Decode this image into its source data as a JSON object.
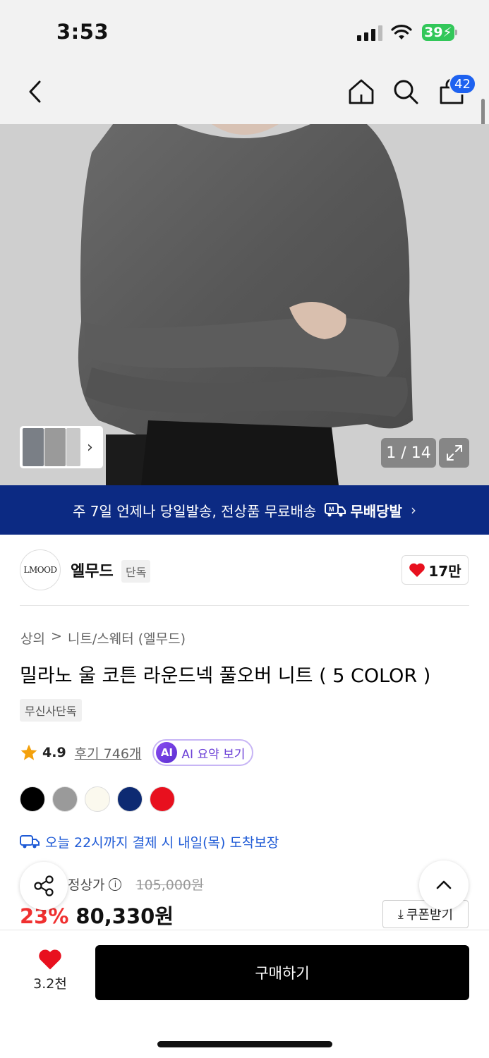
{
  "status_bar": {
    "time": "3:53",
    "battery": "39"
  },
  "nav": {
    "cart_count": "42",
    "icons": [
      "back-icon",
      "home-icon",
      "search-icon",
      "shopping-bag-icon"
    ]
  },
  "gallery": {
    "page_indicator": "1 / 14"
  },
  "banner": {
    "text": "주 7일 언제나 당일발송, 전상품 무료배송",
    "brand_label": "무배당발"
  },
  "brand": {
    "logo_text": "LMOOD",
    "name": "엘무드",
    "tag": "단독",
    "like_count": "17만"
  },
  "product": {
    "breadcrumb": [
      "상의",
      "니트/스웨터 (엘무드)"
    ],
    "title": "밀라노 울 코튼 라운드넥 풀오버 니트 ( 5 COLOR )",
    "exclusive_tag": "무신사단독",
    "rating": "4.9",
    "review_text": "후기 746개",
    "ai_badge": "AI",
    "ai_summary_label": "AI 요약 보기",
    "swatches": [
      "#000000",
      "#9a9a9a",
      "#fbf9ee",
      "#0d2a72",
      "#e8101e"
    ],
    "delivery_text": "오늘 22시까지 결제 시 내일(목) 도착보장",
    "price_label": "정상가",
    "original_price": "105,000원",
    "discount_rate": "23%",
    "sale_price": "80,330원",
    "coupon_label": "쿠폰받기"
  },
  "bottom_bar": {
    "wish_count": "3.2천",
    "buy_label": "구매하기"
  },
  "colors": {
    "accent_blue": "#1e62f0",
    "banner_navy": "#0c2a83",
    "discount_red": "#f03030",
    "heart_red": "#e8101e"
  }
}
